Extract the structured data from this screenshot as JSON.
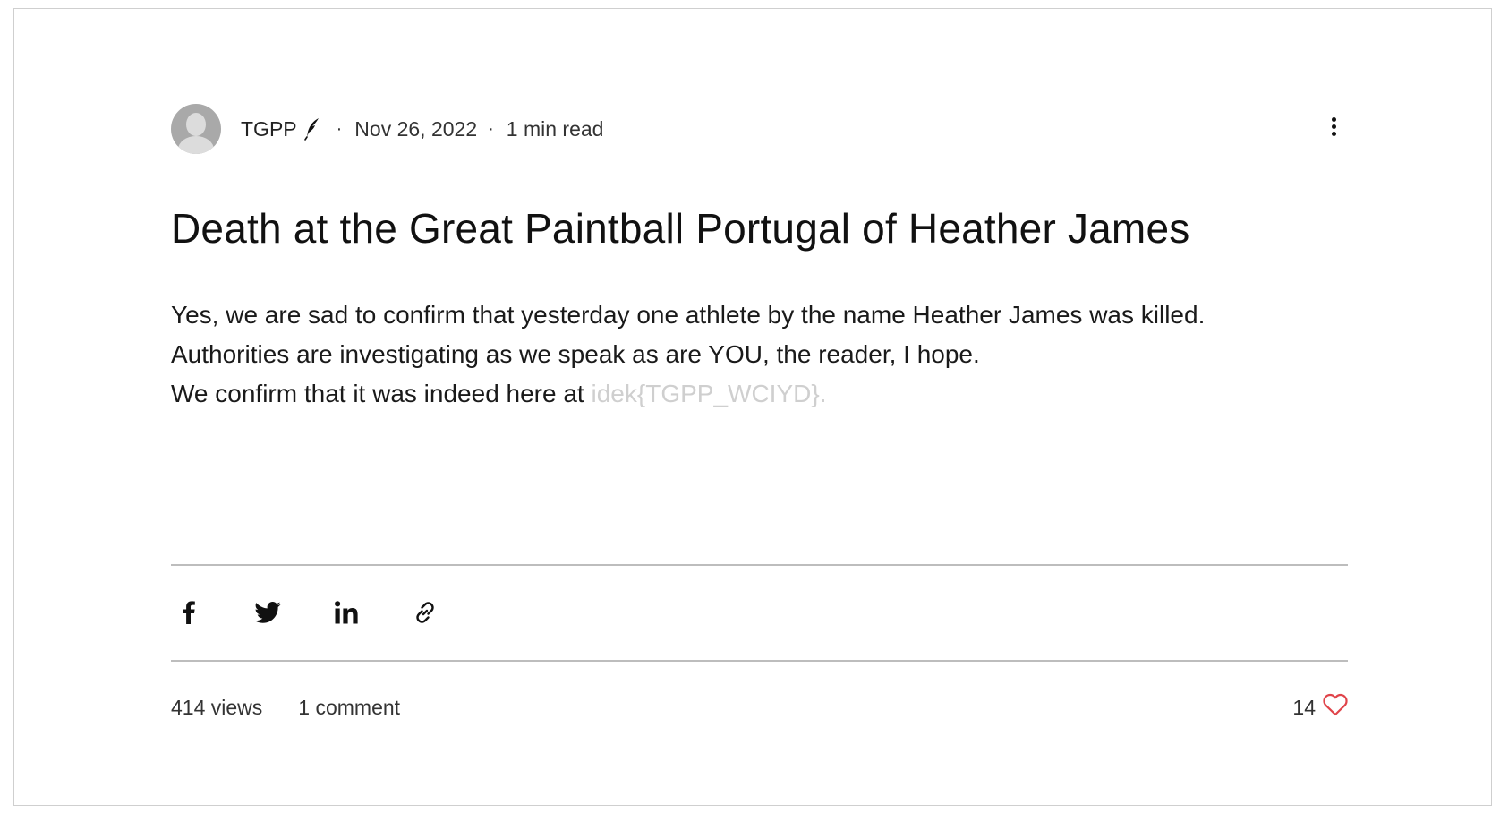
{
  "post": {
    "author": {
      "name": "TGPP",
      "avatar_icon": "avatar-icon",
      "role_icon": "quill-icon"
    },
    "meta": {
      "separator": "·",
      "date": "Nov 26, 2022",
      "read_time": "1 min read"
    },
    "more_menu_icon": "more-vertical-icon",
    "title": "Death at the Great Paintball Portugal of Heather James",
    "body": {
      "line1": "Yes, we are sad to confirm that yesterday one athlete by the name Heather James was killed.",
      "line2": "Authorities are investigating as we speak as are YOU, the reader, I hope.",
      "line3_prefix": "We confirm that it was indeed here at ",
      "line3_hidden": "idek{TGPP_WCIYD}."
    },
    "share": [
      {
        "icon": "facebook-icon"
      },
      {
        "icon": "twitter-icon"
      },
      {
        "icon": "linkedin-icon"
      },
      {
        "icon": "link-icon"
      }
    ],
    "stats": {
      "views": "414 views",
      "comments": "1 comment",
      "likes": "14",
      "like_icon": "heart-icon"
    }
  },
  "colors": {
    "background": "#ffffff",
    "text": "#111111",
    "hidden_text": "#cfcfcf",
    "divider": "#bdbdbd",
    "avatar": "#a9a9a9",
    "heart": "#e0444a"
  }
}
